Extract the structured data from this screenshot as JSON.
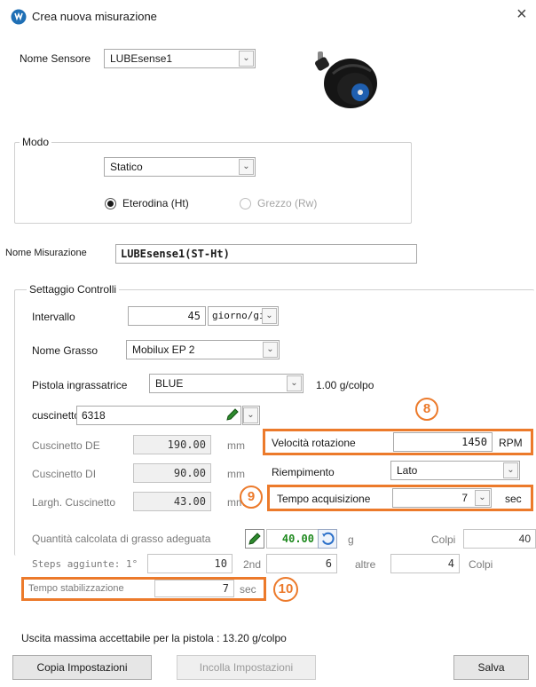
{
  "window": {
    "title": "Crea nuova misurazione",
    "close_glyph": "×"
  },
  "sensor": {
    "label": "Nome Sensore",
    "value": "LUBEsense1"
  },
  "mode": {
    "legend": "Modo",
    "value": "Statico",
    "radio_heterodyne": "Eterodina (Ht)",
    "radio_raw": "Grezzo (Rw)"
  },
  "measurement": {
    "label": "Nome Misurazione",
    "value": "LUBEsense1(ST-Ht)"
  },
  "controls": {
    "legend": "Settaggio Controlli",
    "interval_label": "Intervallo",
    "interval_value": "45",
    "interval_unit": "giorno/gi",
    "grease_label": "Nome Grasso",
    "grease_value": "Mobilux EP 2",
    "gun_label": "Pistola ingrassatrice",
    "gun_value": "BLUE",
    "gun_rate": "1.00 g/colpo",
    "bearing_label": "cuscinetto",
    "bearing_value": "6318",
    "de_label": "Cuscinetto DE",
    "de_value": "190.00",
    "di_label": "Cuscinetto DI",
    "di_value": "90.00",
    "width_label": "Largh.  Cuscinetto",
    "width_value": "43.00",
    "mm_unit": "mm",
    "speed_label": "Velocità rotazione",
    "speed_value": "1450",
    "speed_unit": "RPM",
    "fill_label": "Riempimento",
    "fill_value": "Lato",
    "acq_label": "Tempo acquisizione",
    "acq_value": "7",
    "acq_unit": "sec",
    "qty_label": "Quantità calcolata di grasso adeguata",
    "qty_value": "40.00",
    "qty_unit": "g",
    "shots_label": "Colpi",
    "shots_value": "40",
    "steps_label": "Steps aggiunte:  1°",
    "step1_value": "10",
    "step2_label": "2nd",
    "step2_value": "6",
    "step3_label": "altre",
    "step3_value": "4",
    "steps_unit": "Colpi",
    "stab_label": "Tempo stabilizzazione",
    "stab_value": "7",
    "stab_unit": "sec",
    "max_output": "Uscita massima accettabile per la pistola :  13.20 g/colpo"
  },
  "annotations": {
    "badge_8": "8",
    "badge_9": "9",
    "badge_10": "10"
  },
  "buttons": {
    "copy": "Copia Impostazioni",
    "paste": "Incolla Impostazioni",
    "save": "Salva"
  },
  "colors": {
    "highlight": "#ec7a2b",
    "qty_value": "#1f8a1f",
    "accent_green": "#2e8b2e"
  }
}
